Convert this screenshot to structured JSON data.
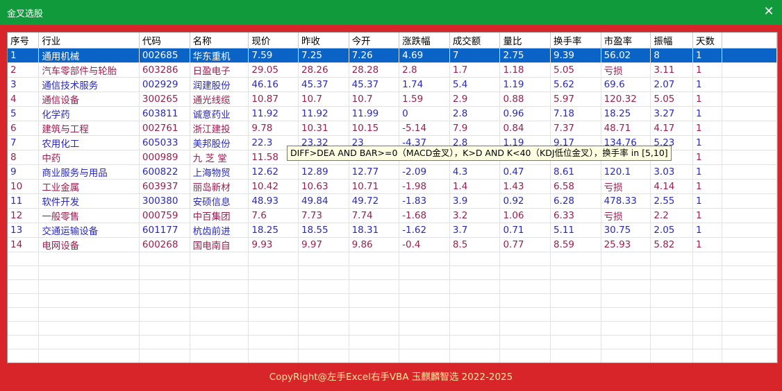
{
  "window": {
    "title": "金叉选股",
    "close_icon": "✕"
  },
  "columns": [
    "序号",
    "行业",
    "代码",
    "名称",
    "现价",
    "昨收",
    "今开",
    "涨跌幅",
    "成交额",
    "量比",
    "换手率",
    "市盈率",
    "振幅",
    "天数"
  ],
  "rows": [
    [
      "1",
      "通用机械",
      "002685",
      "华东重机",
      "7.59",
      "7.25",
      "7.26",
      "4.69",
      "7",
      "2.75",
      "9.39",
      "56.02",
      "8",
      "1"
    ],
    [
      "2",
      "汽车零部件与轮胎",
      "603286",
      "日盈电子",
      "29.05",
      "28.26",
      "28.28",
      "2.8",
      "1.7",
      "1.18",
      "5.05",
      "亏损",
      "3.11",
      "1"
    ],
    [
      "3",
      "通信技术服务",
      "002929",
      "润建股份",
      "46.16",
      "45.37",
      "45.37",
      "1.74",
      "5.4",
      "1.19",
      "5.62",
      "69.6",
      "2.07",
      "1"
    ],
    [
      "4",
      "通信设备",
      "300265",
      "通光线缆",
      "10.87",
      "10.7",
      "10.7",
      "1.59",
      "2.9",
      "0.88",
      "5.97",
      "120.32",
      "5.05",
      "1"
    ],
    [
      "5",
      "化学药",
      "603811",
      "诚意药业",
      "11.92",
      "11.92",
      "11.99",
      "0",
      "2.8",
      "0.96",
      "7.18",
      "18.25",
      "3.27",
      "1"
    ],
    [
      "6",
      "建筑与工程",
      "002761",
      "浙江建投",
      "9.78",
      "10.31",
      "10.15",
      "-5.14",
      "7.9",
      "0.84",
      "7.37",
      "48.71",
      "4.17",
      "1"
    ],
    [
      "7",
      "农用化工",
      "605033",
      "美邦股份",
      "22.3",
      "23.32",
      "23",
      "-4.37",
      "2.8",
      "1.19",
      "9.17",
      "134.76",
      "5.23",
      "1"
    ],
    [
      "8",
      "中药",
      "000989",
      "九 芝 堂",
      "11.58",
      "",
      "",
      "",
      "",
      "",
      "",
      "",
      "",
      "1"
    ],
    [
      "9",
      "商业服务与用品",
      "600822",
      "上海物贸",
      "12.62",
      "12.89",
      "12.77",
      "-2.09",
      "4.3",
      "0.47",
      "8.61",
      "120.1",
      "3.03",
      "1"
    ],
    [
      "10",
      "工业金属",
      "603937",
      "丽岛新材",
      "10.42",
      "10.63",
      "10.71",
      "-1.98",
      "1.4",
      "1.43",
      "6.58",
      "亏损",
      "4.14",
      "1"
    ],
    [
      "11",
      "软件开发",
      "300380",
      "安硕信息",
      "48.93",
      "49.84",
      "49.72",
      "-1.83",
      "3.9",
      "0.92",
      "6.28",
      "478.33",
      "2.55",
      "1"
    ],
    [
      "12",
      "一般零售",
      "000759",
      "中百集团",
      "7.6",
      "7.73",
      "7.74",
      "-1.68",
      "3.2",
      "1.06",
      "6.33",
      "亏损",
      "2.2",
      "1"
    ],
    [
      "13",
      "交通运输设备",
      "601177",
      "杭齿前进",
      "18.25",
      "18.55",
      "18.31",
      "-1.62",
      "3.7",
      "0.71",
      "5.11",
      "30.75",
      "2.05",
      "1"
    ],
    [
      "14",
      "电网设备",
      "600268",
      "国电南自",
      "9.93",
      "9.97",
      "9.86",
      "-0.4",
      "8.5",
      "0.77",
      "8.59",
      "25.93",
      "5.82",
      "1"
    ]
  ],
  "tooltip": "DIFF>DEA AND BAR>=0（MACD金叉），K>D AND K<40（KDJ低位金叉），换手率 in [5,10]",
  "footer": "CopyRight@左手Excel右手VBA 玉麒麟智选  2022-2025",
  "colors": {
    "title_bar": "#119a3c",
    "frame": "#d8252a",
    "selection": "#0a64c8",
    "odd_row_text": "#2a2ab8",
    "even_row_text": "#9a1e4e",
    "footer_text": "#ffe9a0"
  }
}
